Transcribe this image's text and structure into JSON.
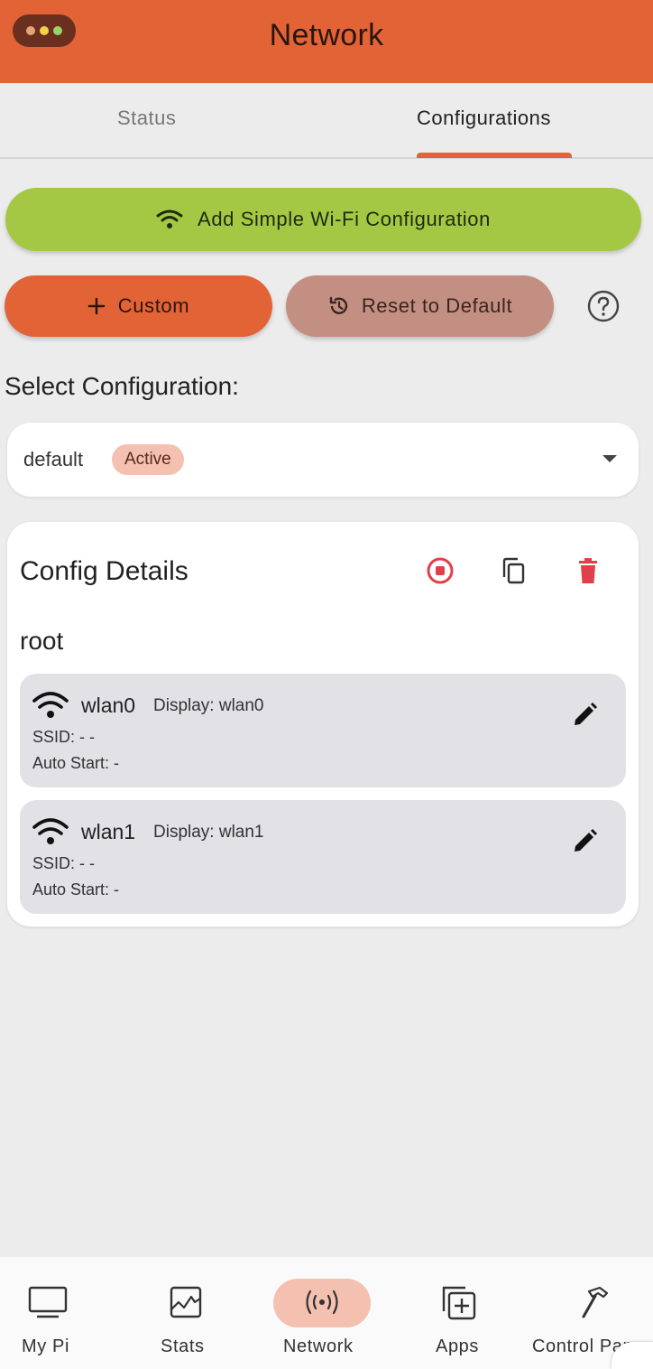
{
  "header": {
    "title": "Network",
    "menu_dots_colors": [
      "#e6a27a",
      "#f2d24a",
      "#9bd36b"
    ]
  },
  "tabs": [
    {
      "label": "Status",
      "selected": false
    },
    {
      "label": "Configurations",
      "selected": true
    }
  ],
  "actions": {
    "add_wifi_label": "Add Simple Wi-Fi Configuration",
    "custom_label": "Custom",
    "reset_label": "Reset to Default",
    "help_icon": "help-circle-icon"
  },
  "selector": {
    "label": "Select Configuration:",
    "value": "default",
    "badge": "Active"
  },
  "config": {
    "title": "Config Details",
    "root_label": "root",
    "interfaces": [
      {
        "name": "wlan0",
        "display": "Display: wlan0",
        "ssid": "SSID: -  -",
        "auto_start": "Auto Start: -"
      },
      {
        "name": "wlan1",
        "display": "Display: wlan1",
        "ssid": "SSID: -  -",
        "auto_start": "Auto Start: -"
      }
    ]
  },
  "bottom_nav": [
    {
      "label": "My Pi",
      "icon": "monitor-icon",
      "selected": false
    },
    {
      "label": "Stats",
      "icon": "chart-icon",
      "selected": false
    },
    {
      "label": "Network",
      "icon": "broadcast-icon",
      "selected": true
    },
    {
      "label": "Apps",
      "icon": "add-app-icon",
      "selected": false
    },
    {
      "label": "Control Pane",
      "icon": "hammer-icon",
      "selected": false
    }
  ],
  "colors": {
    "accent": "#e26436",
    "wifi_button": "#a4c844",
    "reset_button": "#c38f82",
    "danger": "#e0404a",
    "badge": "#f4c0b0"
  }
}
